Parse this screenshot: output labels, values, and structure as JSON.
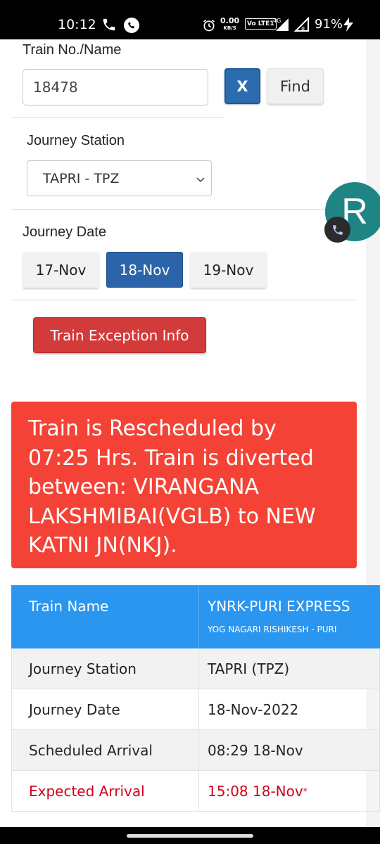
{
  "status_bar": {
    "time": "10:12",
    "net_speed_value": "0.00",
    "net_speed_unit": "KB/S",
    "volte": "Vo LTE1",
    "network_type": "4G",
    "roaming": "R",
    "battery": "91%"
  },
  "form": {
    "train_label": "Train No./Name",
    "train_value": "18478",
    "clear_label": "X",
    "find_label": "Find",
    "station_label": "Journey Station",
    "station_selected": "TAPRI - TPZ",
    "date_label": "Journey Date",
    "dates": [
      "17-Nov",
      "18-Nov",
      "19-Nov"
    ],
    "selected_date": "18-Nov",
    "exception_label": "Train Exception Info"
  },
  "alert": {
    "message": "Train is Rescheduled by 07:25 Hrs. Train is diverted between: VIRANGANA LAKSHMIBAI(VGLB) to NEW KATNI JN(NKJ)."
  },
  "table": {
    "header_label": "Train Name",
    "train_name": "YNRK-PURI EXPRESS",
    "train_route": "YOG NAGARI RISHIKESH - PURI",
    "rows": [
      {
        "label": "Journey Station",
        "value": "TAPRI (TPZ)"
      },
      {
        "label": "Journey Date",
        "value": "18-Nov-2022"
      },
      {
        "label": "Scheduled Arrival",
        "value": "08:29 18-Nov"
      },
      {
        "label": "Expected Arrival",
        "value": "15:08 18-Nov",
        "mark": "*"
      }
    ]
  },
  "chat_bubble": {
    "initial": "R"
  },
  "colors": {
    "primary": "#2b64a8",
    "alert_red": "#f44336",
    "header_blue": "#2b96f0",
    "late_red": "#d0021b"
  }
}
